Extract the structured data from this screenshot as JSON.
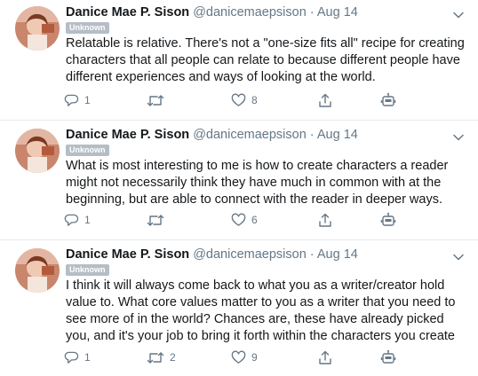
{
  "tweets": [
    {
      "name": "Danice Mae P. Sison",
      "handle": "@danicemaepsison",
      "dot": "·",
      "date": "Aug 14",
      "badge": "Unknown",
      "text": "Relatable is relative. There's not a \"one-size fits all\" recipe for creating characters that all people can relate to because different people have different experiences and ways of looking at the world.",
      "replies": "1",
      "retweets": "",
      "likes": "8"
    },
    {
      "name": "Danice Mae P. Sison",
      "handle": "@danicemaepsison",
      "dot": "·",
      "date": "Aug 14",
      "badge": "Unknown",
      "text": "What is most interesting to me is how to create characters a reader might not necessarily think they have much in common with at the beginning, but are able to connect with the reader in deeper ways.",
      "replies": "1",
      "retweets": "",
      "likes": "6"
    },
    {
      "name": "Danice Mae P. Sison",
      "handle": "@danicemaepsison",
      "dot": "·",
      "date": "Aug 14",
      "badge": "Unknown",
      "text": "I think it will always come back to what you as a writer/creator hold value to. What core values matter to you as a writer that you need to see more of in the world? Chances are, these have already picked you, and it's your job to bring it forth within the characters you create",
      "replies": "1",
      "retweets": "2",
      "likes": "9"
    }
  ],
  "icons": {
    "reply": "reply-icon",
    "retweet": "retweet-icon",
    "like": "heart-icon",
    "share": "share-icon",
    "bot": "robot-icon",
    "caret": "chevron-down-icon"
  },
  "colors": {
    "text": "#14171a",
    "muted": "#657786",
    "badge": "#b5bec6",
    "divider": "#e6ecf0"
  }
}
